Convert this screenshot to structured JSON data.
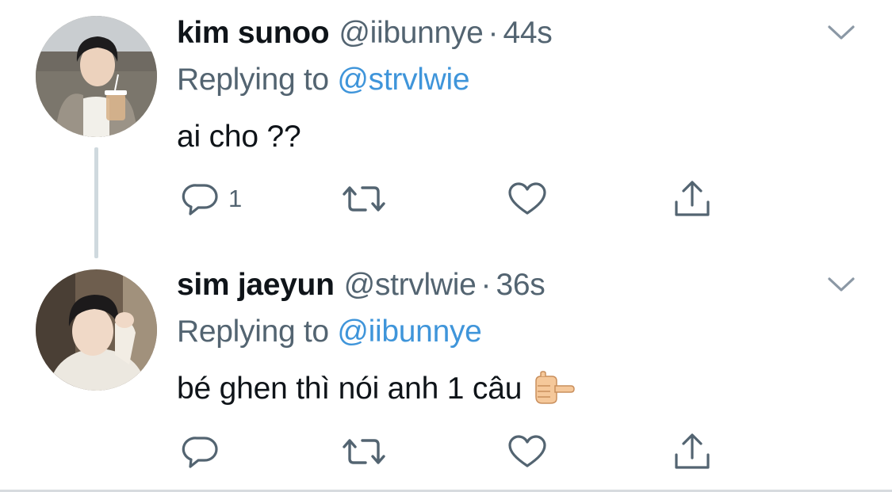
{
  "tweets": [
    {
      "display_name": "kim sunoo",
      "handle": "@iibunnye",
      "separator": "·",
      "time": "44s",
      "replying_prefix": "Replying to",
      "replying_to": "@strvlwie",
      "text": "ai cho ??",
      "reply_count": "1",
      "avatar_icon": "avatar-photo"
    },
    {
      "display_name": "sim jaeyun",
      "handle": "@strvlwie",
      "separator": "·",
      "time": "36s",
      "replying_prefix": "Replying to",
      "replying_to": "@iibunnye",
      "text": "bé ghen thì nói anh 1 câu",
      "emoji_icon": "backhand-pointing-right-emoji",
      "reply_count": "",
      "avatar_icon": "avatar-photo"
    }
  ],
  "colors": {
    "link": "#3f95da",
    "secondary_text": "#536471",
    "thread_line": "#cfd9de"
  }
}
